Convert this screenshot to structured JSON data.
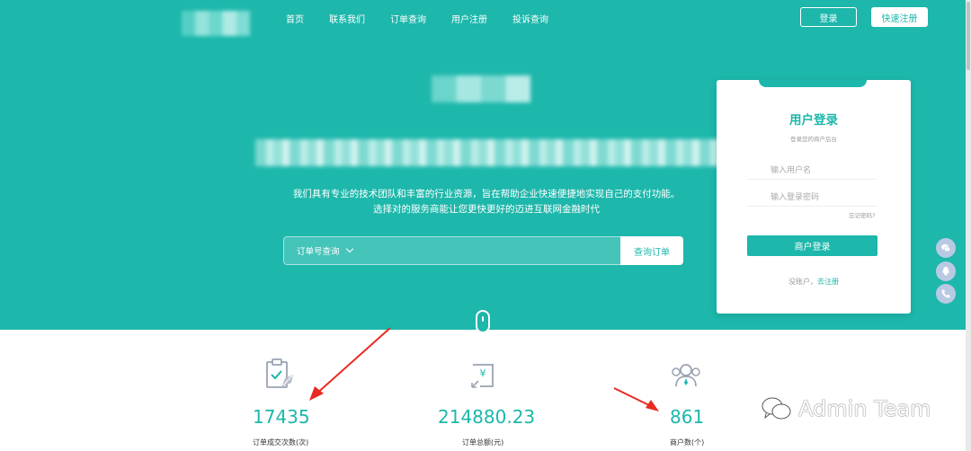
{
  "nav": {
    "items": [
      "首页",
      "联系我们",
      "订单查询",
      "用户注册",
      "投诉查询"
    ],
    "login_label": "登录",
    "register_label": "快速注册"
  },
  "hero": {
    "desc_line1": "我们具有专业的技术团队和丰富的行业资源，旨在帮助企业快速便捷地实现自己的支付功能。",
    "desc_line2": "选择对的服务商能让您更快更好的迈进互联网金融时代"
  },
  "search": {
    "select_label": "订单号查询",
    "button_label": "查询订单"
  },
  "login_card": {
    "title": "用户登录",
    "subtitle": "登录您的商户后台",
    "username_placeholder": "输入用户名",
    "password_placeholder": "输入登录密码",
    "forgot": "忘记密码?",
    "submit": "商户登录",
    "footer_prefix": "没账户，",
    "footer_link": "去注册"
  },
  "stats": [
    {
      "icon": "clipboard-check-icon",
      "value": "17435",
      "label": "订单成交次数(次)"
    },
    {
      "icon": "yuan-transfer-icon",
      "value": "214880.23",
      "label": "订单总额(元)"
    },
    {
      "icon": "users-icon",
      "value": "861",
      "label": "商户数(个)"
    }
  ],
  "watermark": {
    "text": "Admin Team"
  },
  "colors": {
    "brand": "#1db7ab",
    "float_button": "#b9c9e3",
    "annotation_arrow": "#e82a22"
  }
}
